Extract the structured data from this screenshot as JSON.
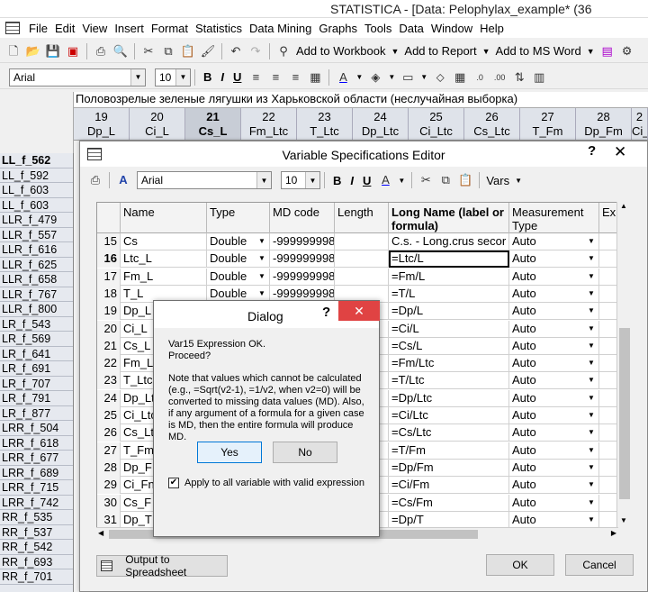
{
  "window": {
    "title": "STATISTICA - [Data: Pelophylax_example* (36"
  },
  "menubar": {
    "items": [
      "File",
      "Edit",
      "View",
      "Insert",
      "Format",
      "Statistics",
      "Data Mining",
      "Graphs",
      "Tools",
      "Data",
      "Window",
      "Help"
    ]
  },
  "toolbar1": {
    "add_workbook": "Add to Workbook",
    "add_report": "Add to Report",
    "add_msword": "Add to MS Word"
  },
  "toolbar2": {
    "font": "Arial",
    "size": "10"
  },
  "sheet": {
    "title": "Половозрелые зеленые лягушки из Харьковской области (неслучайная выборка)",
    "columns": [
      {
        "num": "19",
        "name": "Dp_L"
      },
      {
        "num": "20",
        "name": "Ci_L"
      },
      {
        "num": "21",
        "name": "Cs_L"
      },
      {
        "num": "22",
        "name": "Fm_Ltc"
      },
      {
        "num": "23",
        "name": "T_Ltc"
      },
      {
        "num": "24",
        "name": "Dp_Ltc"
      },
      {
        "num": "25",
        "name": "Ci_Ltc"
      },
      {
        "num": "26",
        "name": "Cs_Ltc"
      },
      {
        "num": "27",
        "name": "T_Fm"
      },
      {
        "num": "28",
        "name": "Dp_Fm"
      },
      {
        "num": "2",
        "name": "Ci_"
      }
    ],
    "rows": [
      "LL_f_562",
      "LL_f_592",
      "LL_f_603",
      "LL_f_603",
      "LLR_f_479",
      "LLR_f_557",
      "LLR_f_616",
      "LLR_f_625",
      "LLR_f_658",
      "LLR_f_767",
      "LLR_f_800",
      "LR_f_543",
      "LR_f_569",
      "LR_f_641",
      "LR_f_691",
      "LR_f_707",
      "LR_f_791",
      "LR_f_877",
      "LRR_f_504",
      "LRR_f_618",
      "LRR_f_677",
      "LRR_f_689",
      "LRR_f_715",
      "LRR_f_742",
      "RR_f_535",
      "RR_f_537",
      "RR_f_542",
      "RR_f_693",
      "RR_f_701"
    ]
  },
  "vse": {
    "title": "Variable Specifications Editor",
    "font": "Arial",
    "size": "10",
    "vars_label": "Vars",
    "headers": {
      "name": "Name",
      "type": "Type",
      "md": "MD code",
      "length": "Length",
      "longname": "Long Name (label or formula)",
      "measurement": "Measurement Type",
      "ex": "Ex"
    },
    "rows": [
      {
        "n": "15",
        "name": "Cs",
        "type": "Double",
        "md": "-999999998",
        "long": "C.s. - Long.crus secor",
        "meas": "Auto"
      },
      {
        "n": "16",
        "name": "Ltc_L",
        "type": "Double",
        "md": "-999999998",
        "long": "=Ltc/L",
        "meas": "Auto"
      },
      {
        "n": "17",
        "name": "Fm_L",
        "type": "Double",
        "md": "-999999998",
        "long": "=Fm/L",
        "meas": "Auto"
      },
      {
        "n": "18",
        "name": "T_L",
        "type": "Double",
        "md": "-999999998",
        "long": "=T/L",
        "meas": "Auto"
      },
      {
        "n": "19",
        "name": "Dp_L",
        "type": "",
        "md": "",
        "long": "=Dp/L",
        "meas": "Auto"
      },
      {
        "n": "20",
        "name": "Ci_L",
        "type": "",
        "md": "",
        "long": "=Ci/L",
        "meas": "Auto"
      },
      {
        "n": "21",
        "name": "Cs_L",
        "type": "",
        "md": "",
        "long": "=Cs/L",
        "meas": "Auto"
      },
      {
        "n": "22",
        "name": "Fm_L",
        "type": "",
        "md": "",
        "long": "=Fm/Ltc",
        "meas": "Auto"
      },
      {
        "n": "23",
        "name": "T_Ltc",
        "type": "",
        "md": "",
        "long": "=T/Ltc",
        "meas": "Auto"
      },
      {
        "n": "24",
        "name": "Dp_Lt",
        "type": "",
        "md": "",
        "long": "=Dp/Ltc",
        "meas": "Auto"
      },
      {
        "n": "25",
        "name": "Ci_Ltc",
        "type": "",
        "md": "",
        "long": "=Ci/Ltc",
        "meas": "Auto"
      },
      {
        "n": "26",
        "name": "Cs_Lt",
        "type": "",
        "md": "",
        "long": "=Cs/Ltc",
        "meas": "Auto"
      },
      {
        "n": "27",
        "name": "T_Fm",
        "type": "",
        "md": "",
        "long": "=T/Fm",
        "meas": "Auto"
      },
      {
        "n": "28",
        "name": "Dp_F",
        "type": "",
        "md": "",
        "long": "=Dp/Fm",
        "meas": "Auto"
      },
      {
        "n": "29",
        "name": "Ci_Fn",
        "type": "",
        "md": "",
        "long": "=Ci/Fm",
        "meas": "Auto"
      },
      {
        "n": "30",
        "name": "Cs_F",
        "type": "",
        "md": "",
        "long": "=Cs/Fm",
        "meas": "Auto"
      },
      {
        "n": "31",
        "name": "Dp_T",
        "type": "Double",
        "md": "-999999998",
        "long": "=Dp/T",
        "meas": "Auto"
      }
    ],
    "output_btn": "Output to Spreadsheet",
    "ok_btn": "OK",
    "cancel_btn": "Cancel"
  },
  "dialog": {
    "title": "Dialog",
    "line1": "Var15 Expression OK.",
    "line2": "Proceed?",
    "note": "Note that values which cannot be calculated (e.g., =Sqrt(v2-1), =1/v2, when v2=0) will be converted to missing data values (MD). Also, if any argument of a formula for a given case is MD, then the entire formula will produce MD.",
    "yes": "Yes",
    "no": "No",
    "checkbox": "Apply to all variable with valid expression"
  }
}
